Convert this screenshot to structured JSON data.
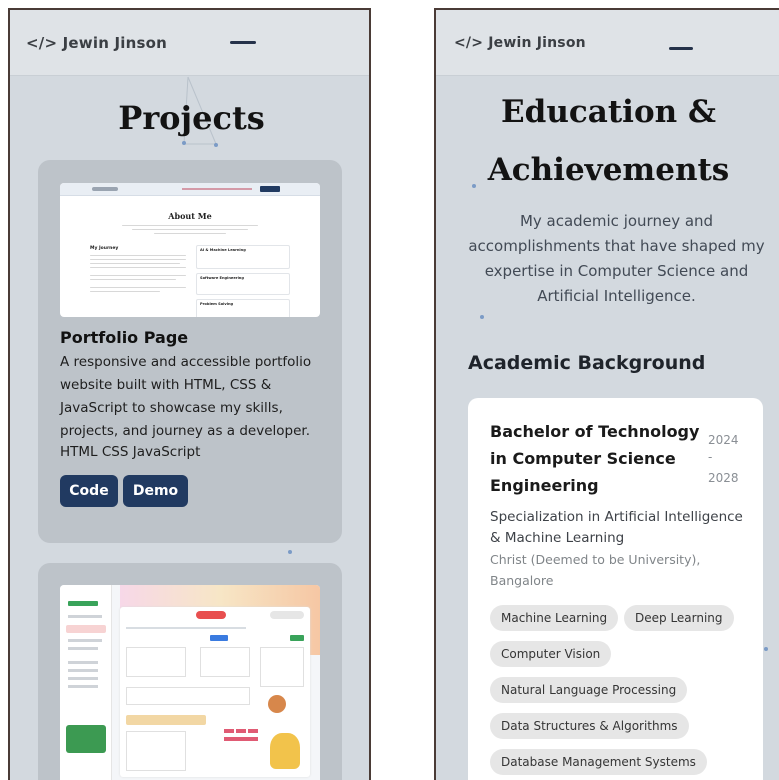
{
  "left": {
    "brand": "</> Jewin Jinson",
    "section_title": "Projects",
    "project1": {
      "title": "Portfolio Page",
      "description": "A responsive and accessible portfolio website built with HTML, CSS & JavaScript to showcase my skills, projects, and journey as a developer.",
      "tech": "HTML CSS JavaScript",
      "code_label": "Code",
      "demo_label": "Demo",
      "preview": {
        "heading": "About Me",
        "journey": "My Journey",
        "card1": "AI & Machine Learning",
        "card2": "Software Engineering",
        "card3": "Problem Solving"
      }
    }
  },
  "right": {
    "brand": "</> Jewin Jinson",
    "title_line1": "Education &",
    "title_line2": "Achievements",
    "intro": "My academic journey and accomplishments that have shaped my expertise in Computer Science and Artificial Intelligence.",
    "section_heading": "Academic Background",
    "degree": {
      "title": "Bachelor of Technology in Computer Science Engineering",
      "year_start": "2024",
      "year_sep": "-",
      "year_end": "2028",
      "specialization": "Specialization in Artificial Intelligence & Machine Learning",
      "institution": "Christ (Deemed to be University), Bangalore",
      "tags": [
        "Machine Learning",
        "Deep Learning",
        "Computer Vision",
        "Natural Language Processing",
        "Data Structures & Algorithms",
        "Database Management Systems"
      ]
    }
  }
}
